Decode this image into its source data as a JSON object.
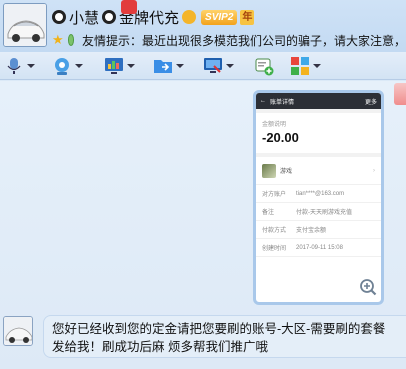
{
  "header": {
    "name": "小慧",
    "title_suffix": "金牌代充",
    "vip_badge": "SVIP2",
    "year_badge": "年",
    "notice_text": "友情提示：最近出现很多模范我们公司的骗子，请大家注意，"
  },
  "toolbar": {
    "items": [
      "microphone",
      "camera",
      "screen-share",
      "file-transfer",
      "remote-desktop",
      "add-app",
      "more-apps"
    ]
  },
  "screenshot": {
    "top_bar_title": "账单详情",
    "top_bar_right": "更多",
    "amount_label": "金额说明",
    "amount": "-20.00",
    "item_label": "游戏",
    "rows": [
      {
        "label": "对方账户",
        "value": "tian****@163.com"
      },
      {
        "label": "备注",
        "value": "付款-天天刷游戏充值"
      },
      {
        "label": "付款方式",
        "value": "支付宝余额"
      },
      {
        "label": "创建时间",
        "value": "2017-09-11 15:08"
      }
    ]
  },
  "message": {
    "text_line1": "您好已经收到您的定金请把您要刷的账号-大区-需要刷的套餐",
    "text_line2": "发给我！刷成功后麻  烦多帮我们推广哦"
  },
  "colors": {
    "header_bg": "#cfe2f6",
    "chat_bg": "#e6f0fa",
    "accent": "#3a8ee6"
  }
}
